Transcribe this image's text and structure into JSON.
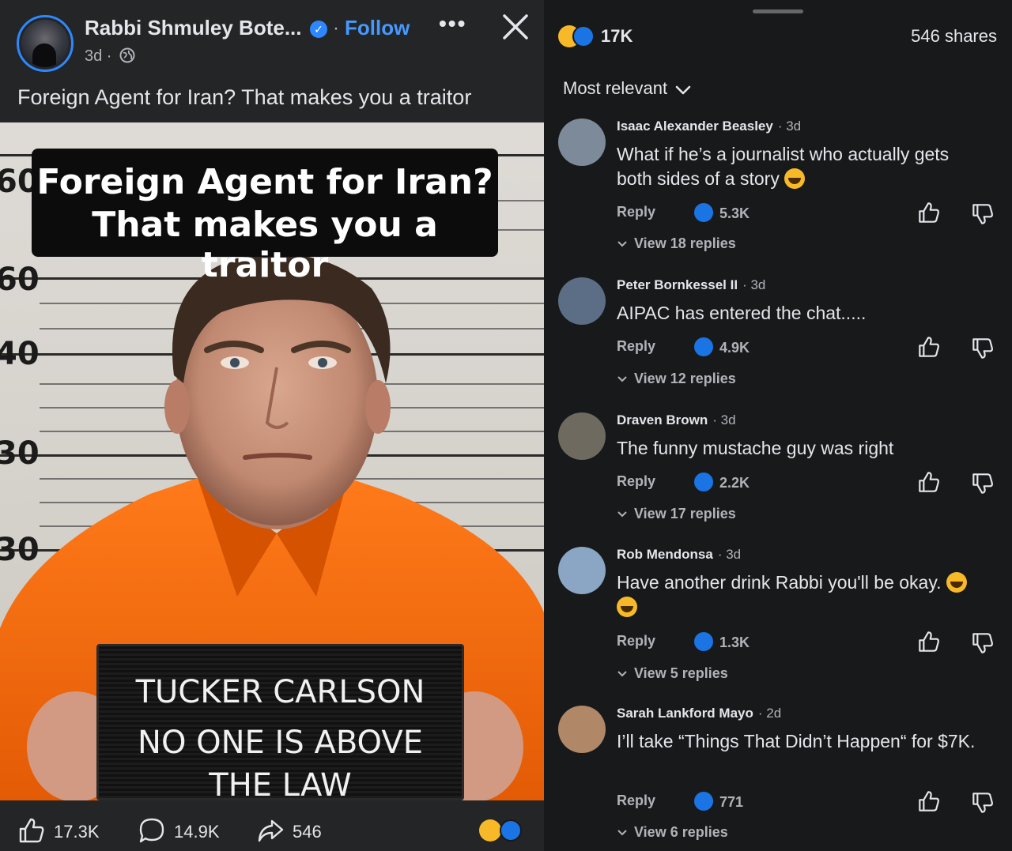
{
  "post": {
    "page_name": "Rabbi Shmuley Bote...",
    "follow_label": "Follow",
    "more_label": "•••",
    "time": "3d ·",
    "caption": "Foreign Agent for Iran? That makes you a traitor",
    "image": {
      "overlay_line1": "Foreign Agent for Iran?",
      "overlay_line2": "That makes you a traitor",
      "ruler_numbers": [
        "60",
        "60",
        "40",
        "30",
        "30"
      ],
      "placard_line1": "TUCKER CARLSON",
      "placard_line2": "NO ONE IS ABOVE",
      "placard_line3": "THE LAW"
    },
    "actions": {
      "likes": "17.3K",
      "comments": "14.9K",
      "shares": "546"
    }
  },
  "sheet": {
    "reaction_total": "17K",
    "shares_label": "546 shares",
    "sort_label": "Most relevant"
  },
  "comments": [
    {
      "author": "Isaac Alexander Beasley",
      "time": "· 3d",
      "text": "What if he’s a journalist who actually gets both sides of a story",
      "reply_label": "Reply",
      "likes": "5.3K",
      "view_replies": "View 18 replies",
      "avatar_color": "#7d8a9a"
    },
    {
      "author": "Peter Bornkessel II",
      "time": "· 3d",
      "text": "AIPAC has entered the chat.....",
      "reply_label": "Reply",
      "likes": "4.9K",
      "view_replies": "View 12 replies",
      "avatar_color": "#5c6e86"
    },
    {
      "author": "Draven Brown",
      "time": "· 3d",
      "text": "The funny mustache guy was right",
      "reply_label": "Reply",
      "likes": "2.2K",
      "view_replies": "View 17 replies",
      "avatar_color": "#6f6a60"
    },
    {
      "author": "Rob Mendonsa",
      "time": "· 3d",
      "text": "Have another drink Rabbi you'll be okay.",
      "reply_label": "Reply",
      "likes": "1.3K",
      "view_replies": "View 5 replies",
      "avatar_color": "#8aa6c4"
    },
    {
      "author": "Sarah Lankford Mayo",
      "time": "· 2d",
      "text": "I’ll take “Things That Didn’t Happen“ for $7K.",
      "reply_label": "Reply",
      "likes": "771",
      "view_replies": "View 6 replies",
      "avatar_color": "#b08868"
    }
  ],
  "colors": {
    "accent": "#2d88ff",
    "like_blue": "#1b74e4",
    "haha_yellow": "#f7b928",
    "panel_bg": "#242526",
    "sheet_bg": "#18191b"
  }
}
